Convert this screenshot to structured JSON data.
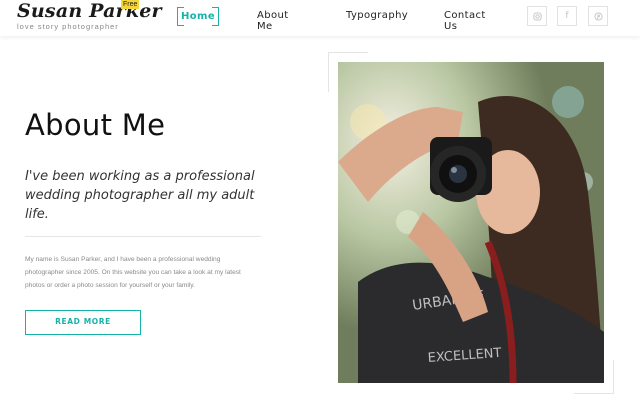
{
  "header": {
    "logo_name": "Susan Parker",
    "logo_badge": "Free",
    "logo_tagline": "love story photographer",
    "nav": [
      {
        "label": "Home",
        "active": true
      },
      {
        "label": "About Me"
      },
      {
        "label": "Typography"
      },
      {
        "label": "Contact Us"
      }
    ],
    "social_icons": [
      "instagram-icon",
      "facebook-icon",
      "pinterest-icon"
    ]
  },
  "main": {
    "title": "About Me",
    "lead": "I've been working as a professional wedding photographer all my adult life.",
    "body": "My name is Susan Parker, and I have been a professional wedding photographer since 2005. On this website you can take a look at my latest photos or order a photo session for yourself or your family.",
    "button_label": "READ MORE"
  },
  "colors": {
    "accent": "#16b3a8",
    "badge": "#f3d53a"
  }
}
